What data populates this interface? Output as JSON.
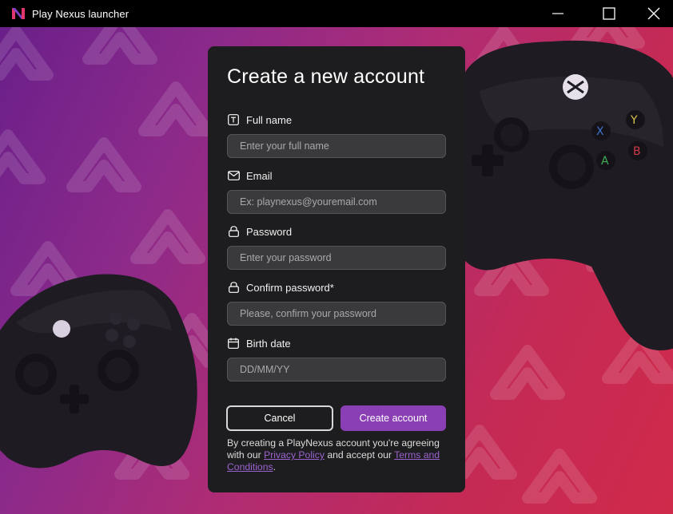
{
  "window": {
    "title": "Play Nexus launcher",
    "logo_icon": "nexus-logo-icon",
    "controls": [
      "minimize-icon",
      "maximize-icon",
      "close-icon"
    ]
  },
  "colors": {
    "accent": "#8a3fb4",
    "dialog_bg": "#1d1d1f",
    "input_bg": "#3a3a3d",
    "link": "#9b63cf",
    "bg_gradient_start": "#6a1f8a",
    "bg_gradient_end": "#d02a4a"
  },
  "form": {
    "title": "Create a new account",
    "fields": [
      {
        "icon": "text-field-icon",
        "label": "Full name",
        "placeholder": "Enter your full name",
        "value": ""
      },
      {
        "icon": "mail-icon",
        "label": "Email",
        "placeholder": "Ex: playnexus@youremail.com",
        "value": ""
      },
      {
        "icon": "lock-icon",
        "label": "Password",
        "placeholder": "Enter your password",
        "value": ""
      },
      {
        "icon": "lock-icon",
        "label": "Confirm password*",
        "placeholder": "Please, confirm your password",
        "value": ""
      },
      {
        "icon": "calendar-icon",
        "label": "Birth date",
        "placeholder": "DD/MM/YY",
        "value": ""
      }
    ],
    "cancel_label": "Cancel",
    "create_label": "Create account",
    "legal": {
      "prefix": "By creating a PlayNexus account you're agreeing with our",
      "privacy_link": "Privacy Policy",
      "middle": "and accept our",
      "terms_link": "Terms and Conditions",
      "suffix": "."
    }
  }
}
